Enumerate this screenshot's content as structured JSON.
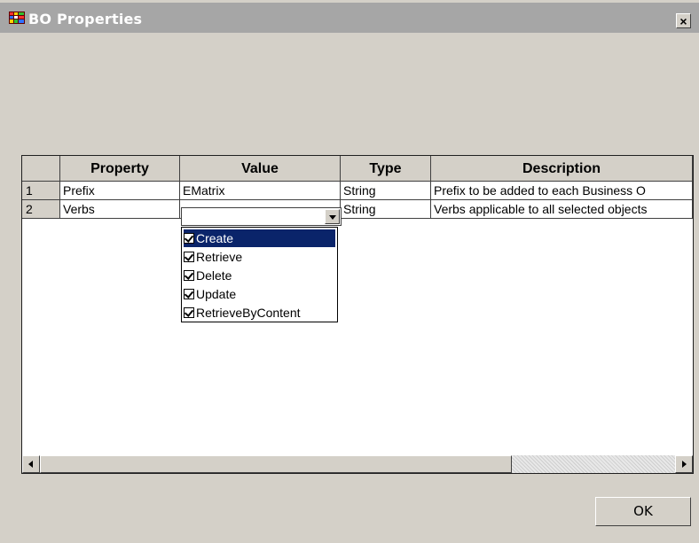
{
  "window": {
    "title": "BO Properties",
    "close_label": "×"
  },
  "grid": {
    "columns": [
      "",
      "Property",
      "Value",
      "Type",
      "Description"
    ],
    "rows": [
      {
        "num": "1",
        "property": "Prefix",
        "value": "EMatrix",
        "type": "String",
        "description": "Prefix to be added to each Business O"
      },
      {
        "num": "2",
        "property": "Verbs",
        "value": "",
        "type": "String",
        "description": "Verbs applicable to all selected objects"
      }
    ]
  },
  "verbs_dropdown": {
    "options": [
      {
        "label": "Create",
        "checked": true,
        "selected": true
      },
      {
        "label": "Retrieve",
        "checked": true,
        "selected": false
      },
      {
        "label": "Delete",
        "checked": true,
        "selected": false
      },
      {
        "label": "Update",
        "checked": true,
        "selected": false
      },
      {
        "label": "RetrieveByContent",
        "checked": true,
        "selected": false
      }
    ]
  },
  "ok_button": {
    "label": "OK"
  },
  "colors": {
    "selection": "#0a246a",
    "titlebar": "#a6a6a6",
    "face": "#d4d0c8"
  }
}
